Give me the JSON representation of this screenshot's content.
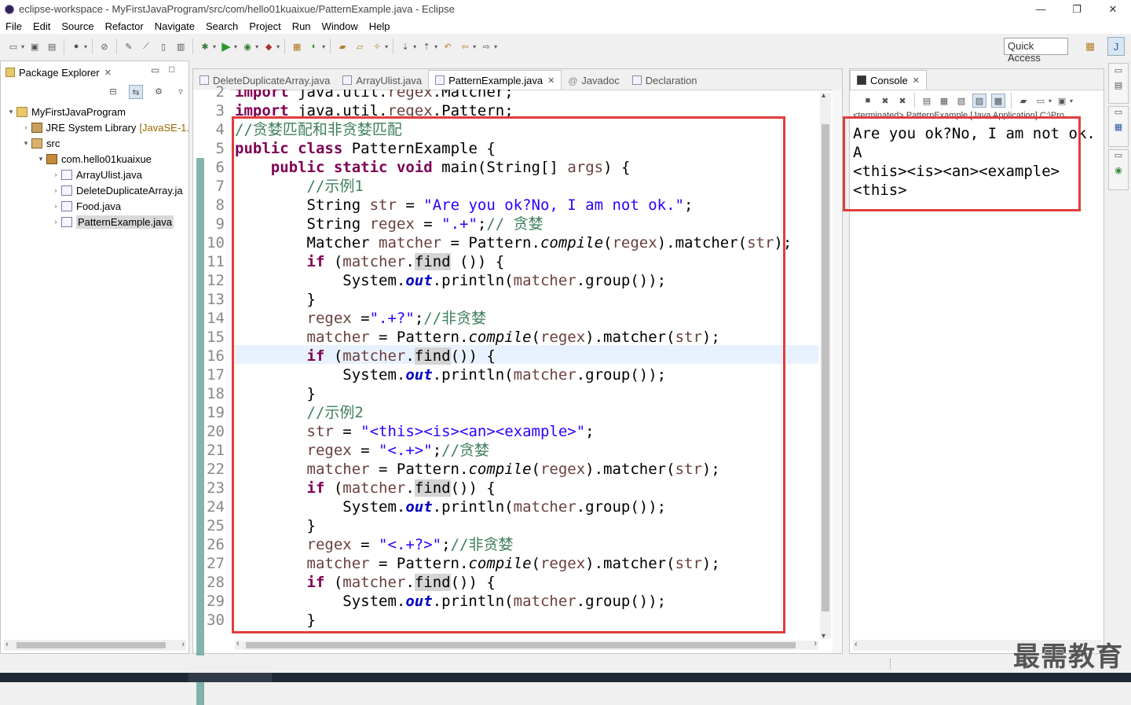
{
  "window": {
    "title": "eclipse-workspace - MyFirstJavaProgram/src/com/hello01kuaixue/PatternExample.java - Eclipse",
    "minimize": "—",
    "restore": "❐",
    "close": "✕"
  },
  "menu": [
    "File",
    "Edit",
    "Source",
    "Refactor",
    "Navigate",
    "Search",
    "Project",
    "Run",
    "Window",
    "Help"
  ],
  "toolbar": {
    "quick_access": "Quick Access"
  },
  "package_explorer": {
    "title": "Package Explorer",
    "tree": [
      {
        "label": "MyFirstJavaProgram",
        "depth": 0,
        "icon": "project",
        "arrow": "▾"
      },
      {
        "label": "JRE System Library",
        "suffix": "[JavaSE-1.",
        "depth": 1,
        "icon": "library",
        "arrow": "›"
      },
      {
        "label": "src",
        "depth": 1,
        "icon": "source-folder",
        "arrow": "▾"
      },
      {
        "label": "com.hello01kuaixue",
        "depth": 2,
        "icon": "package",
        "arrow": "▾"
      },
      {
        "label": "ArrayUlist.java",
        "depth": 3,
        "icon": "java-file",
        "arrow": "›"
      },
      {
        "label": "DeleteDuplicateArray.ja",
        "depth": 3,
        "icon": "java-file",
        "arrow": "›"
      },
      {
        "label": "Food.java",
        "depth": 3,
        "icon": "java-file",
        "arrow": "›"
      },
      {
        "label": "PatternExample.java",
        "depth": 3,
        "icon": "java-file",
        "arrow": "›",
        "selected": true
      }
    ]
  },
  "editor": {
    "tabs": [
      {
        "label": "DeleteDuplicateArray.java",
        "active": false
      },
      {
        "label": "ArrayUlist.java",
        "active": false
      },
      {
        "label": "PatternExample.java",
        "active": true
      },
      {
        "label": "Javadoc",
        "active": false
      },
      {
        "label": "Declaration",
        "active": false
      }
    ],
    "line_numbers": [
      "2",
      "3",
      "4",
      "5",
      "6",
      "7",
      "8",
      "9",
      "10",
      "11",
      "12",
      "13",
      "14",
      "15",
      "16",
      "17",
      "18",
      "19",
      "20",
      "21",
      "22",
      "23",
      "24",
      "25",
      "26",
      "27",
      "28",
      "29",
      "30"
    ],
    "lines": [
      "import java.util.regex.Matcher;",
      "import java.util.regex.Pattern;",
      "//贪婪匹配和非贪婪匹配",
      "public class PatternExample {",
      "    public static void main(String[] args) {",
      "        //示例1",
      "        String str = \"Are you ok?No, I am not ok.\";",
      "        String regex = \".+\";// 贪婪",
      "        Matcher matcher = Pattern.compile(regex).matcher(str);",
      "        if (matcher.find ()) {",
      "            System.out.println(matcher.group());",
      "        }",
      "        regex =\".+?\";//非贪婪",
      "        matcher = Pattern.compile(regex).matcher(str);",
      "        if (matcher.find()) {",
      "            System.out.println(matcher.group());",
      "        }",
      "        //示例2",
      "        str = \"<this><is><an><example>\";",
      "        regex = \"<.+>\";//贪婪",
      "        matcher = Pattern.compile(regex).matcher(str);",
      "        if (matcher.find()) {",
      "            System.out.println(matcher.group());",
      "        }",
      "        regex = \"<.+?>\";//非贪婪",
      "        matcher = Pattern.compile(regex).matcher(str);",
      "        if (matcher.find()) {",
      "            System.out.println(matcher.group());",
      "        }"
    ]
  },
  "console": {
    "title": "Console",
    "header": "<terminated> PatternExample [Java Application] C:\\Pro",
    "output": [
      "Are you ok?No, I am not ok.",
      "A",
      "<this><is><an><example>",
      "<this>"
    ]
  },
  "watermark": "最需教育",
  "colors": {
    "highlight_box": "#e13c3c",
    "keyword": "#7f0055",
    "string": "#2a00ff",
    "comment": "#3f7f5f",
    "field": "#0000c0"
  }
}
